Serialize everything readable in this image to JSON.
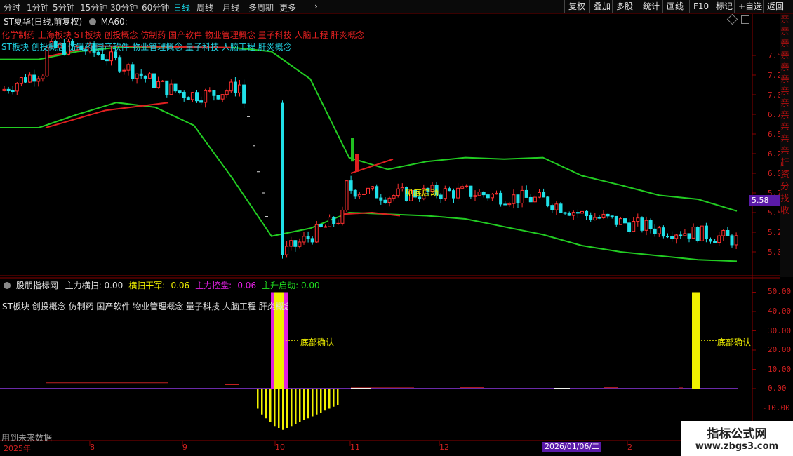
{
  "toolbar": {
    "periods": [
      "分时",
      "1分钟",
      "5分钟",
      "15分钟",
      "30分钟",
      "60分钟",
      "日线",
      "周线",
      "月线",
      "多周期",
      "更多"
    ],
    "active": "日线",
    "more_arrow": "›",
    "right_buttons": [
      "复权",
      "叠加",
      "多股",
      "统计",
      "画线",
      "F10",
      "标记",
      "+自选",
      "返回"
    ]
  },
  "main_chart": {
    "title": "ST夏华(日线,前复权)",
    "ma_label": "MA60: -",
    "concepts_red": "化学制药 上海板块 ST板块 创投概念 仿制药 国产软件 物业管理概念 量子科技 人脑工程 肝炎概念",
    "concepts_cyan": "ST板块 创投概念 仿制药 国产软件 物业管理概念 量子科技 人脑工程 肝炎概念",
    "annotation": "见底启动",
    "price_axis": [
      "7.50",
      "7.25",
      "7.00",
      "6.75",
      "6.50",
      "6.25",
      "6.00",
      "5.75",
      "5.50",
      "5.25",
      "5.00"
    ],
    "current_price": "5.58"
  },
  "indicator": {
    "name": "股朋指标网",
    "values": [
      {
        "label": "主力横扫: 0.00",
        "color": "#e0e0e0"
      },
      {
        "label": "横扫干军: -0.06",
        "color": "#f0f000"
      },
      {
        "label": "主力控盘: -0.06",
        "color": "#e020e0"
      },
      {
        "label": "主升启动: 0.00",
        "color": "#20e020"
      }
    ],
    "concepts": "ST板块 创投概念 仿制药 国产软件 物业管理概念 量子科技 人脑工程 肝炎概念",
    "annotation_1": "底部确认",
    "annotation_2": "底部确认",
    "axis": [
      "50.00",
      "40.00",
      "30.00",
      "20.00",
      "10.00",
      "0.00",
      "-10.00"
    ],
    "footnote": "用到未来数据"
  },
  "date_axis": {
    "labels": [
      "2025年",
      "8",
      "9",
      "10",
      "11",
      "12",
      "2"
    ],
    "cursor_date": "2026/01/06/二"
  },
  "side_strip": "亲亲亲亲亲亲亲亲亲亲亲亲 赶 资 分 找 收",
  "watermark": {
    "title": "指标公式网",
    "url": "www.zbgs3.com"
  },
  "chart_data": {
    "type": "candlestick",
    "title": "ST夏华(日线,前复权)",
    "price_range": [
      4.85,
      7.7
    ],
    "upper_band_approx": [
      7.45,
      7.45,
      7.55,
      7.6,
      7.6,
      7.6,
      7.6,
      7.55,
      7.2,
      6.2,
      6.05,
      6.15,
      6.2,
      6.18,
      6.2,
      5.97,
      5.85,
      5.72,
      5.67,
      5.52
    ],
    "lower_band_approx": [
      6.58,
      6.58,
      6.75,
      6.9,
      6.84,
      6.61,
      5.93,
      5.2,
      5.3,
      5.5,
      5.48,
      5.46,
      5.42,
      5.32,
      5.22,
      5.08,
      5.0,
      4.95,
      4.9,
      4.88
    ],
    "current_price": 5.58,
    "indicator_range": [
      -12,
      55
    ],
    "indicator_events": [
      {
        "signal": "底部确认",
        "value": 50
      },
      {
        "signal": "底部确认",
        "value": 50
      }
    ]
  }
}
